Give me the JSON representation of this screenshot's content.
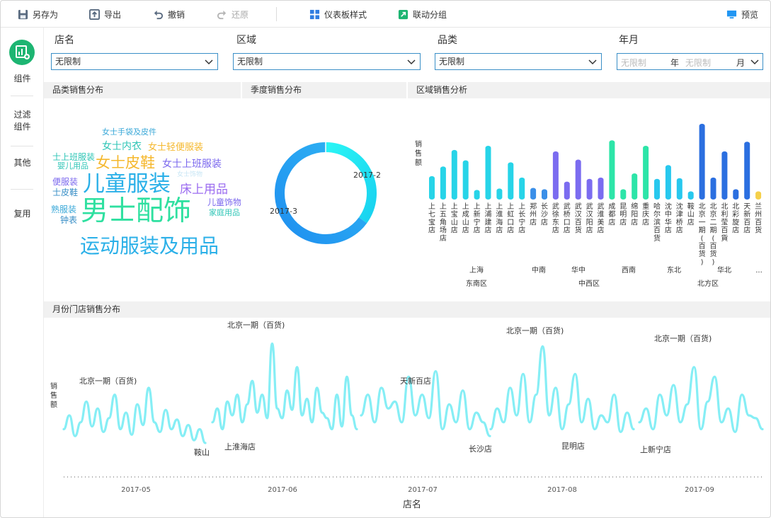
{
  "toolbar": {
    "save_as": "另存为",
    "export": "导出",
    "undo": "撤销",
    "redo": "还原",
    "dashboard_style": "仪表板样式",
    "linkage_group": "联动分组",
    "preview": "预览"
  },
  "sidebar": {
    "components": "组件",
    "filter_l1": "过滤",
    "filter_l2": "组件",
    "other": "其他",
    "reuse": "复用"
  },
  "filters": {
    "store": {
      "label": "店名",
      "value": "无限制"
    },
    "region": {
      "label": "区域",
      "value": "无限制"
    },
    "category": {
      "label": "品类",
      "value": "无限制"
    },
    "yearmonth": {
      "label": "年月",
      "year_placeholder": "无限制",
      "year_unit": "年",
      "month_placeholder": "无限制",
      "month_unit": "月"
    }
  },
  "panels": {
    "wordcloud_title": "品类销售分布",
    "donut_title": "季度销售分布",
    "region_title": "区域销售分析",
    "monthly_title": "月份门店销售分布"
  },
  "colors": {
    "accent": "#3a8fc7",
    "green": "#1db572",
    "line": "#86eef5"
  },
  "wordcloud": [
    {
      "text": "女士手袋及皮件",
      "color": "#3aa8d8"
    },
    {
      "text": "女士内衣",
      "color": "#2ec5b6"
    },
    {
      "text": "女士轻便服装",
      "color": "#f5b82e"
    },
    {
      "text": "士上班服装",
      "color": "#2ec5b6"
    },
    {
      "text": "女士皮鞋",
      "color": "#f5b82e"
    },
    {
      "text": "女士上班服装",
      "color": "#7b68ee"
    },
    {
      "text": "婴儿用品",
      "color": "#2ec5b6"
    },
    {
      "text": "女士饰物",
      "color": "#c8e6f5"
    },
    {
      "text": "便服装",
      "color": "#7b68ee"
    },
    {
      "text": "儿童服装",
      "color": "#2bb0e8"
    },
    {
      "text": "床上用品",
      "color": "#9b6cf0"
    },
    {
      "text": "士皮鞋",
      "color": "#3a8fc7"
    },
    {
      "text": "儿童饰物",
      "color": "#7b68ee"
    },
    {
      "text": "熟服装",
      "color": "#3aa8d8"
    },
    {
      "text": "男士配饰",
      "color": "#2fe0a0"
    },
    {
      "text": "家庭用品",
      "color": "#2ec5b6"
    },
    {
      "text": "钟表",
      "color": "#3a8fc7"
    },
    {
      "text": "运动服装及用品",
      "color": "#2bb0e8"
    }
  ],
  "chart_data": [
    {
      "type": "pie",
      "title": "季度销售分布",
      "categories": [
        "2017-2",
        "2017-3"
      ],
      "values": [
        35,
        65
      ],
      "colors": [
        "#2cf0f0",
        "#2196f3"
      ]
    },
    {
      "type": "bar",
      "title": "区域销售分析",
      "ylabel": "销售额",
      "categories": [
        "上七宝店",
        "上五角场店",
        "上宝山店",
        "上成山店",
        "上新宁店",
        "上浦建店",
        "上淮海店",
        "上虹口店",
        "上长宁店",
        "郑州店",
        "长沙店",
        "武徐东店",
        "武桥口店",
        "武汉百货",
        "武汉阳店",
        "武淮美店",
        "成都店",
        "昆明店",
        "绵阳店",
        "重庆店",
        "哈尔滨百货",
        "沈中华店",
        "沈津桥店",
        "鞍山店",
        "北京一期(百货)",
        "北京二期(百货)",
        "北利莹百貨",
        "北彩旋店",
        "天新百店",
        "兰州百货"
      ],
      "values": [
        34,
        48,
        72,
        57,
        14,
        78,
        16,
        54,
        32,
        17,
        15,
        70,
        26,
        58,
        30,
        32,
        86,
        15,
        38,
        78,
        30,
        50,
        31,
        12,
        110,
        32,
        70,
        15,
        84,
        12
      ],
      "bar_colors": [
        "#27d4e8",
        "#27d4e8",
        "#27d4e8",
        "#27d4e8",
        "#27d4e8",
        "#27d4e8",
        "#27d4e8",
        "#27d4e8",
        "#27d4e8",
        "#3a8fe8",
        "#3a8fe8",
        "#7b6cf0",
        "#7b6cf0",
        "#7b6cf0",
        "#7b6cf0",
        "#7b6cf0",
        "#2de5a8",
        "#2de5a8",
        "#2de5a8",
        "#2de5a8",
        "#27c8ee",
        "#27c8ee",
        "#27c8ee",
        "#27c8ee",
        "#2b6fe0",
        "#2b6fe0",
        "#2b6fe0",
        "#2b6fe0",
        "#2b6fe0",
        "#f5d04a"
      ],
      "group_labels": [
        "上海",
        "中南",
        "华中",
        "西南",
        "东北",
        "华北",
        "..."
      ],
      "region_labels": [
        "东南区",
        "中西区",
        "北方区"
      ]
    },
    {
      "type": "line",
      "title": "月份门店销售分布",
      "ylabel": "销售额",
      "xlabel": "店名",
      "x_ticks": [
        "2017-05",
        "2017-06",
        "2017-07",
        "2017-08",
        "2017-09"
      ],
      "annotations": [
        {
          "text": "北京一期（百货)"
        },
        {
          "text": "鞍山"
        },
        {
          "text": "北京一期（百货)"
        },
        {
          "text": "上淮海店"
        },
        {
          "text": "天新百店"
        },
        {
          "text": "长沙店"
        },
        {
          "text": "北京一期（百货)"
        },
        {
          "text": "昆明店"
        },
        {
          "text": "北京一期（百货)"
        },
        {
          "text": "上新宁店"
        }
      ],
      "series": [
        {
          "values": [
            30,
            40,
            25,
            35,
            50,
            32,
            45,
            28,
            38,
            55,
            30,
            42,
            26,
            48,
            33,
            60,
            35,
            28,
            44,
            30,
            37,
            25,
            33,
            22,
            30,
            20
          ]
        },
        {
          "values": [
            35,
            45,
            30,
            50,
            40,
            55,
            35,
            48,
            65,
            42,
            55,
            38,
            92,
            45,
            38,
            58,
            44,
            75,
            40,
            52,
            35,
            60,
            42,
            38,
            30,
            55,
            32,
            68,
            40,
            30
          ]
        },
        {
          "values": [
            40,
            55,
            35,
            60,
            45,
            50,
            35,
            68,
            40,
            55,
            38,
            72,
            30,
            48,
            35,
            58,
            30,
            42,
            35,
            25
          ]
        },
        {
          "values": [
            30,
            45,
            35,
            60,
            40,
            70,
            35,
            55,
            90,
            40,
            60,
            30,
            48,
            70,
            35,
            52,
            30,
            40,
            35,
            55,
            28,
            42,
            30
          ]
        },
        {
          "values": [
            35,
            45,
            30,
            55,
            40,
            62,
            35,
            48,
            75,
            30,
            50,
            68,
            35,
            45,
            28,
            55,
            40,
            38,
            30
          ]
        }
      ]
    }
  ]
}
